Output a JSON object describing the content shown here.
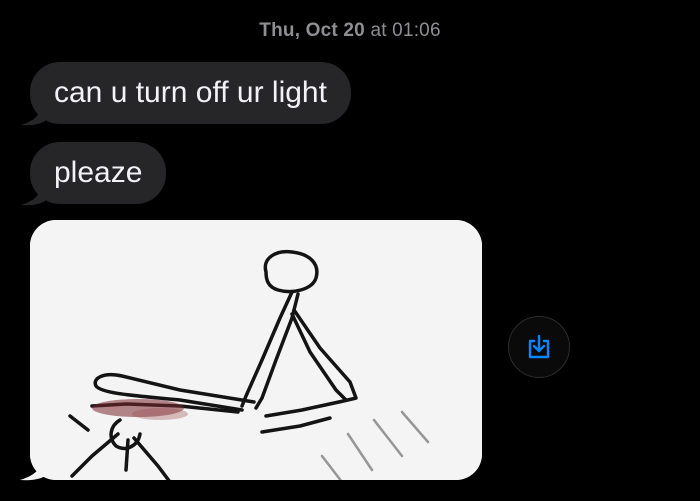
{
  "conversation": {
    "timestamp": {
      "day": "Thu, Oct 20",
      "time": "at 01:06"
    },
    "messages": [
      {
        "text": "can u turn off ur light"
      },
      {
        "text": "pleaze"
      }
    ],
    "image_message": {
      "content": "stick-figure-drawing"
    },
    "save_action": {
      "icon": "save-to-device-icon"
    }
  },
  "colors": {
    "background": "#000000",
    "incoming_bubble": "#262628",
    "bubble_text": "#f2f2f7",
    "timestamp_text": "#8e8e93",
    "accent": "#0a84ff"
  }
}
